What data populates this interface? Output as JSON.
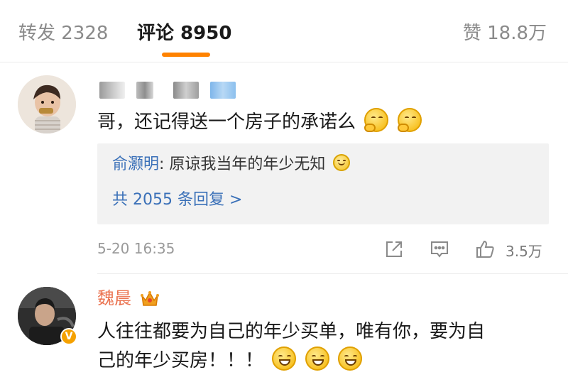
{
  "tabs": {
    "repost": "转发 2328",
    "comments": "评论 8950",
    "likes": "赞 18.8万"
  },
  "comments": [
    {
      "text": "哥，还记得送一个房子的承诺么",
      "emojis": [
        "thinking-emoji",
        "thinking-emoji"
      ],
      "reply": {
        "author": "俞灏明",
        "separator": ": ",
        "text": "原谅我当年的年少无知",
        "more": "共 2055 条回复 >"
      },
      "time": "5-20 16:35",
      "likes": "3.5万"
    },
    {
      "author": "魏晨",
      "line1": "人往往都要为自己的年少买单，唯有你，要为自",
      "line2": "己的年少买房！！！",
      "emojis": [
        "grin-emoji",
        "grin-emoji",
        "grin-emoji"
      ],
      "badge": "V"
    }
  ],
  "colors": {
    "accent": "#ff8200",
    "link": "#3a70b8",
    "vip_name": "#eb7350"
  }
}
